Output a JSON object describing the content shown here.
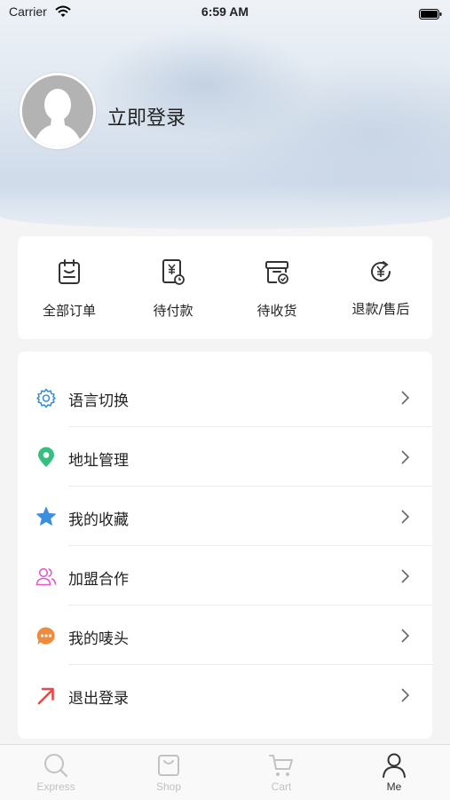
{
  "status_bar": {
    "carrier": "Carrier",
    "time": "6:59 AM"
  },
  "profile": {
    "login_label": "立即登录"
  },
  "orders": [
    {
      "label": "全部订单",
      "icon": "clipboard-icon"
    },
    {
      "label": "待付款",
      "icon": "payment-pending-icon"
    },
    {
      "label": "待收货",
      "icon": "package-receive-icon"
    },
    {
      "label": "退款/售后",
      "icon": "refund-icon"
    }
  ],
  "menu": [
    {
      "label": "语言切换",
      "icon": "gear-icon",
      "color": "#3b8fd9"
    },
    {
      "label": "地址管理",
      "icon": "location-pin-icon",
      "color": "#35c07f"
    },
    {
      "label": "我的收藏",
      "icon": "star-icon",
      "color": "#3a8fe0"
    },
    {
      "label": "加盟合作",
      "icon": "users-icon",
      "color": "#e05ad0"
    },
    {
      "label": "我的唛头",
      "icon": "chat-bubble-icon",
      "color": "#f08a3c"
    },
    {
      "label": "退出登录",
      "icon": "arrow-up-right-icon",
      "color": "#e24b4b"
    }
  ],
  "tabbar": [
    {
      "label": "Express",
      "icon": "search-icon",
      "active": false
    },
    {
      "label": "Shop",
      "icon": "shop-bag-icon",
      "active": false
    },
    {
      "label": "Cart",
      "icon": "cart-icon",
      "active": false
    },
    {
      "label": "Me",
      "icon": "person-icon",
      "active": true
    }
  ],
  "colors": {
    "accent_text": "#222222",
    "inactive_tab": "#c2c2c2",
    "active_tab": "#333333"
  }
}
